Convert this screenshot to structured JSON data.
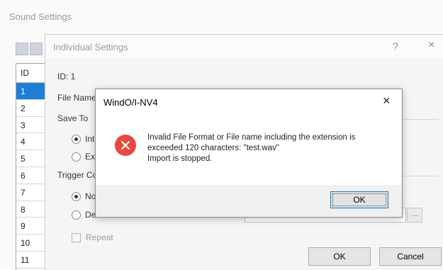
{
  "sound_window": {
    "title": "Sound Settings",
    "list_header": "ID",
    "ids": [
      "1",
      "2",
      "3",
      "4",
      "5",
      "6",
      "7",
      "8",
      "9",
      "10",
      "11"
    ],
    "selected_id": "1"
  },
  "individual_settings": {
    "title": "Individual Settings",
    "help": "?",
    "close": "×",
    "id_label": "ID: 1",
    "file_name_label": "File Name",
    "save_to_label": "Save To",
    "save_option_1": "Int",
    "save_option_2": "Ex",
    "trigger_label": "Trigger Co",
    "trigger_option_1": "No",
    "trigger_option_2": "Device Address:",
    "repeat_label": "Repeat",
    "browse_label": "...",
    "ok_label": "OK",
    "cancel_label": "Cancel"
  },
  "message_box": {
    "title": "WindO/I-NV4",
    "close": "×",
    "icon": "error-icon",
    "icon_color": "#e8483f",
    "lines": [
      "Invalid File Format or File name including the extension is",
      "exceeded 120 characters: \"test.wav\"",
      "Import is stopped."
    ],
    "ok_label": "OK"
  },
  "colors": {
    "selection": "#1f7fd7",
    "focus_border": "#0078d7"
  }
}
